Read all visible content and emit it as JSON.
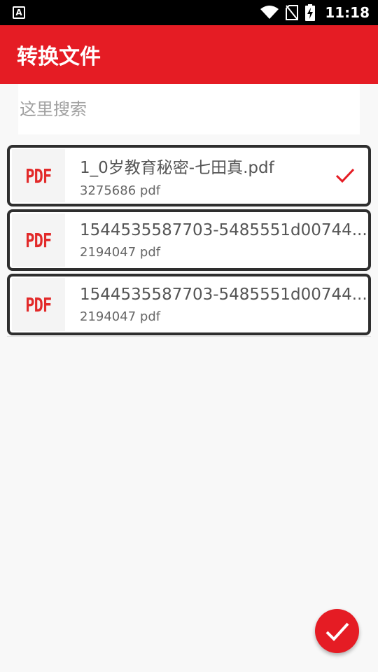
{
  "status_bar": {
    "time": "11:18",
    "icons": [
      "a-icon",
      "wifi-icon",
      "no-sim-icon",
      "battery-charging-icon"
    ]
  },
  "app_bar": {
    "title": "转换文件",
    "color": "#e51c24"
  },
  "search": {
    "placeholder": "这里搜索",
    "value": ""
  },
  "files": [
    {
      "thumb_label": "PDF",
      "name": "1_0岁教育秘密-七田真.pdf",
      "size": "3275686",
      "type": "pdf",
      "selected": true
    },
    {
      "thumb_label": "PDF",
      "name": "1544535587703-5485551d00744...",
      "size": "2194047",
      "type": "pdf",
      "selected": false
    },
    {
      "thumb_label": "PDF",
      "name": "1544535587703-5485551d00744...",
      "size": "2194047",
      "type": "pdf",
      "selected": false
    }
  ],
  "fab": {
    "icon": "check-icon",
    "color": "#e51c24"
  }
}
